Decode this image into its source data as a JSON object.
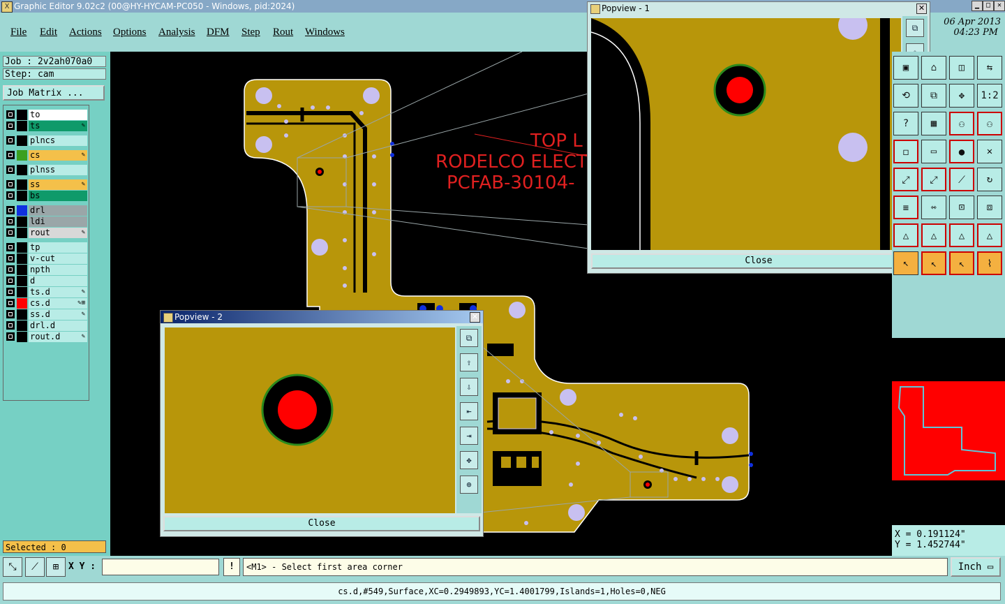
{
  "window": {
    "title": "Graphic Editor 9.02c2 (00@HY-HYCAM-PC050 - Windows, pid:2024)"
  },
  "menu": [
    "File",
    "Edit",
    "Actions",
    "Options",
    "Analysis",
    "DFM",
    "Step",
    "Rout",
    "Windows"
  ],
  "datetime": {
    "date": "06 Apr 2013",
    "time": "04:23 PM"
  },
  "job": {
    "job_label": "Job : 2v2ah070a0",
    "step_label": "Step: cam",
    "matrix_button": "Job Matrix ..."
  },
  "layers": [
    {
      "name": "to",
      "bg": "#ffffff",
      "swatch": "#000000",
      "mark": ""
    },
    {
      "name": "ts",
      "bg": "#0f9a6a",
      "swatch": "#000000",
      "mark": "✎"
    },
    {
      "name": "plncs",
      "bg": "#b8ece6",
      "swatch": "#000000",
      "mark": ""
    },
    {
      "name": "cs",
      "bg": "#f4c04a",
      "swatch": "#3aa020",
      "mark": "✎"
    },
    {
      "name": "plnss",
      "bg": "#b8ece6",
      "swatch": "#000000",
      "mark": ""
    },
    {
      "name": "ss",
      "bg": "#f4c04a",
      "swatch": "#000000",
      "mark": "✎"
    },
    {
      "name": "bs",
      "bg": "#0f9a6a",
      "swatch": "#000000",
      "mark": ""
    },
    {
      "name": "drl",
      "bg": "#9aa6a8",
      "swatch": "#1030e0",
      "mark": ""
    },
    {
      "name": "ldi",
      "bg": "#9aa6a8",
      "swatch": "#000000",
      "mark": ""
    },
    {
      "name": "rout",
      "bg": "#d8d8d8",
      "swatch": "#000000",
      "mark": "✎"
    },
    {
      "name": "tp",
      "bg": "#b8ece6",
      "swatch": "#000000",
      "mark": ""
    },
    {
      "name": "v-cut",
      "bg": "#b8ece6",
      "swatch": "#000000",
      "mark": ""
    },
    {
      "name": "npth",
      "bg": "#b8ece6",
      "swatch": "#000000",
      "mark": ""
    },
    {
      "name": "d",
      "bg": "#b8ece6",
      "swatch": "#000000",
      "mark": ""
    },
    {
      "name": "ts.d",
      "bg": "#b8ece6",
      "swatch": "#000000",
      "mark": "✎"
    },
    {
      "name": "cs.d",
      "bg": "#b8ece6",
      "swatch": "#ff0000",
      "mark": "✎⊞"
    },
    {
      "name": "ss.d",
      "bg": "#b8ece6",
      "swatch": "#000000",
      "mark": "✎"
    },
    {
      "name": "drl.d",
      "bg": "#b8ece6",
      "swatch": "#000000",
      "mark": ""
    },
    {
      "name": "rout.d",
      "bg": "#b8ece6",
      "swatch": "#000000",
      "mark": "✎"
    }
  ],
  "selected": "Selected : 0",
  "silkscreen": {
    "line1": "TOP L",
    "line2": "RODELCO ELECT",
    "line3": "PCFAB-30104-"
  },
  "popview1": {
    "title": "Popview - 1",
    "close": "Close"
  },
  "popview2": {
    "title": "Popview - 2",
    "close": "Close"
  },
  "coords": {
    "x": "X = 0.191124\"",
    "y": "Y = 1.452744\""
  },
  "command": {
    "xy_label": "X Y :",
    "xy_value": "",
    "bang": "!",
    "prompt": "<M1> - Select first area corner",
    "unit": "Inch"
  },
  "status": "cs.d,#549,Surface,XC=0.2949893,YC=1.4001799,Islands=1,Holes=0,NEG",
  "colors": {
    "copper": "#b8960a",
    "pad": "#c8c0f0",
    "outline": "#ffffff",
    "silk": "#e02020",
    "panel": "#9fd8d4",
    "overview": "#ff0000"
  }
}
